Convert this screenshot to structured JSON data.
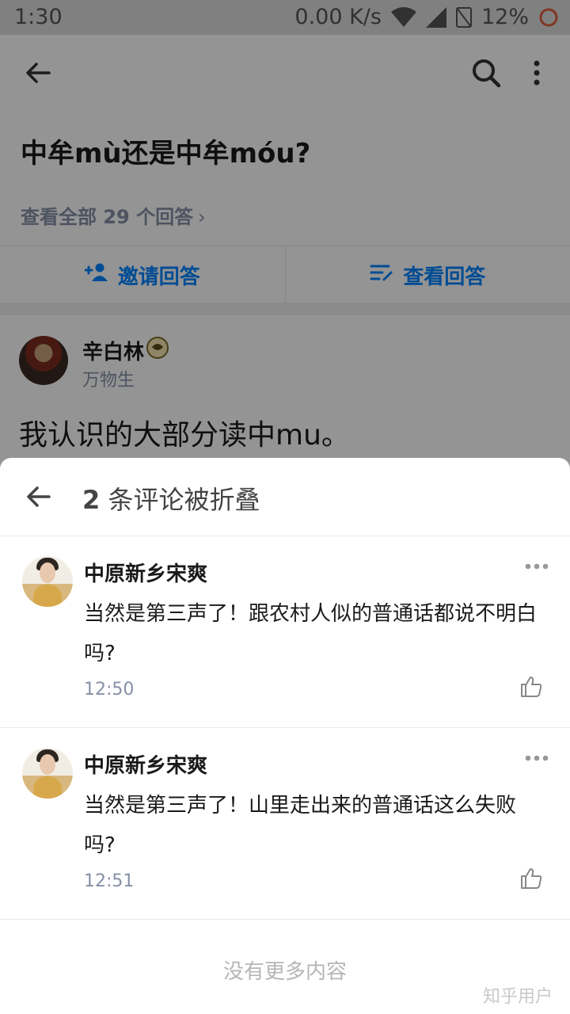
{
  "status_bar": {
    "time": "1:30",
    "network_speed": "0.00 K/s",
    "battery": "12%"
  },
  "question": {
    "title": "中牟mù还是中牟móu?",
    "view_all": "查看全部 29 个回答",
    "view_all_arrow": "›"
  },
  "actions": {
    "invite_label": "邀请回答",
    "view_label": "查看回答"
  },
  "answer": {
    "author_name": "辛白林",
    "author_bio": "万物生",
    "text": "我认识的大部分读中mu。"
  },
  "sheet": {
    "count": "2",
    "title_suffix": " 条评论被折叠",
    "comments": [
      {
        "name": "中原新乡宋爽",
        "text": "当然是第三声了！跟农村人似的普通话都说不明白吗?",
        "time": "12:50"
      },
      {
        "name": "中原新乡宋爽",
        "text": "当然是第三声了！山里走出来的普通话这么失败吗?",
        "time": "12:51"
      }
    ],
    "no_more": "没有更多内容"
  },
  "watermark": "知乎用户",
  "colors": {
    "accent": "#0084ff",
    "meta": "#8590a6"
  },
  "icons": [
    "back-icon",
    "search-icon",
    "more-vertical-icon",
    "invite-icon",
    "view-answers-icon",
    "more-horizontal-icon",
    "thumbs-up-icon",
    "badge-icon"
  ]
}
